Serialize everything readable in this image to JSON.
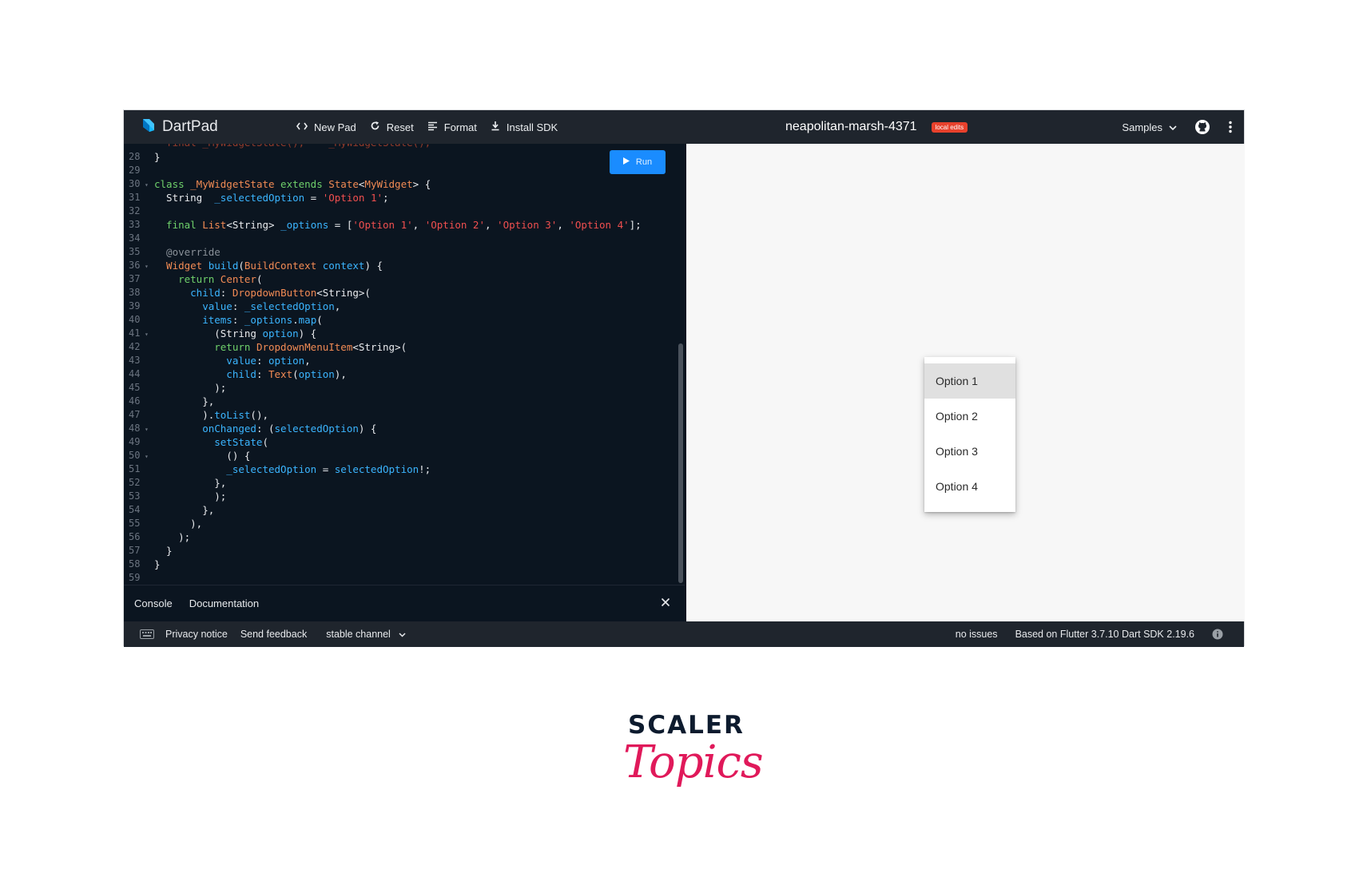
{
  "app": {
    "brand": "DartPad",
    "toolbar": {
      "new_pad": "New Pad",
      "reset": "Reset",
      "format": "Format",
      "install_sdk": "Install SDK"
    },
    "pad_name": "neapolitan-marsh-4371",
    "local_edits_badge": "local edits",
    "samples": "Samples",
    "icons": {
      "brand": "dart-logo-icon",
      "new_pad": "code-brackets-icon",
      "reset": "refresh-icon",
      "format": "align-lines-icon",
      "install_sdk": "download-icon",
      "samples": "chevron-down-icon",
      "github": "github-icon",
      "more": "more-vert-icon"
    },
    "colors": {
      "topbar": "#1f252d",
      "editor_bg": "#0b1520",
      "run_button": "#1a8cff",
      "badge": "#e8412c",
      "output_bg": "#f7f7f7"
    }
  },
  "editor": {
    "run_label": "Run",
    "lines": [
      {
        "n": "28",
        "fold": "",
        "tokens": [
          {
            "t": "}",
            "c": "plain"
          }
        ]
      },
      {
        "n": "29",
        "fold": "",
        "tokens": []
      },
      {
        "n": "30",
        "fold": "▾",
        "tokens": [
          {
            "t": "class ",
            "c": "green"
          },
          {
            "t": "_MyWidgetState",
            "c": "type"
          },
          {
            "t": " extends ",
            "c": "green"
          },
          {
            "t": "State",
            "c": "type"
          },
          {
            "t": "<",
            "c": "plain"
          },
          {
            "t": "MyWidget",
            "c": "type"
          },
          {
            "t": "> {",
            "c": "plain"
          }
        ]
      },
      {
        "n": "31",
        "fold": "",
        "tokens": [
          {
            "t": "  String  ",
            "c": "plain"
          },
          {
            "t": "_selectedOption",
            "c": "blue"
          },
          {
            "t": " = ",
            "c": "plain"
          },
          {
            "t": "'Option 1'",
            "c": "str"
          },
          {
            "t": ";",
            "c": "plain"
          }
        ]
      },
      {
        "n": "32",
        "fold": "",
        "tokens": []
      },
      {
        "n": "33",
        "fold": "",
        "tokens": [
          {
            "t": "  final ",
            "c": "green"
          },
          {
            "t": "List",
            "c": "type"
          },
          {
            "t": "<String> ",
            "c": "plain"
          },
          {
            "t": "_options",
            "c": "blue"
          },
          {
            "t": " = [",
            "c": "plain"
          },
          {
            "t": "'Option 1'",
            "c": "str"
          },
          {
            "t": ", ",
            "c": "plain"
          },
          {
            "t": "'Option 2'",
            "c": "str"
          },
          {
            "t": ", ",
            "c": "plain"
          },
          {
            "t": "'Option 3'",
            "c": "str"
          },
          {
            "t": ", ",
            "c": "plain"
          },
          {
            "t": "'Option 4'",
            "c": "str"
          },
          {
            "t": "];",
            "c": "plain"
          }
        ]
      },
      {
        "n": "34",
        "fold": "",
        "tokens": []
      },
      {
        "n": "35",
        "fold": "",
        "tokens": [
          {
            "t": "  @override",
            "c": "ann"
          }
        ]
      },
      {
        "n": "36",
        "fold": "▾",
        "tokens": [
          {
            "t": "  Widget ",
            "c": "type"
          },
          {
            "t": "build",
            "c": "blue"
          },
          {
            "t": "(",
            "c": "plain"
          },
          {
            "t": "BuildContext",
            "c": "type"
          },
          {
            "t": " context",
            "c": "blue"
          },
          {
            "t": ") {",
            "c": "plain"
          }
        ]
      },
      {
        "n": "37",
        "fold": "",
        "tokens": [
          {
            "t": "    return ",
            "c": "green"
          },
          {
            "t": "Center",
            "c": "type"
          },
          {
            "t": "(",
            "c": "plain"
          }
        ]
      },
      {
        "n": "38",
        "fold": "",
        "tokens": [
          {
            "t": "      child",
            "c": "blue"
          },
          {
            "t": ": ",
            "c": "plain"
          },
          {
            "t": "DropdownButton",
            "c": "type"
          },
          {
            "t": "<String>(",
            "c": "plain"
          }
        ]
      },
      {
        "n": "39",
        "fold": "",
        "tokens": [
          {
            "t": "        value",
            "c": "blue"
          },
          {
            "t": ": ",
            "c": "plain"
          },
          {
            "t": "_selectedOption",
            "c": "blue"
          },
          {
            "t": ",",
            "c": "plain"
          }
        ]
      },
      {
        "n": "40",
        "fold": "",
        "tokens": [
          {
            "t": "        items",
            "c": "blue"
          },
          {
            "t": ": ",
            "c": "plain"
          },
          {
            "t": "_options",
            "c": "blue"
          },
          {
            "t": ".",
            "c": "plain"
          },
          {
            "t": "map",
            "c": "blue"
          },
          {
            "t": "(",
            "c": "plain"
          }
        ]
      },
      {
        "n": "41",
        "fold": "▾",
        "tokens": [
          {
            "t": "          (String ",
            "c": "plain"
          },
          {
            "t": "option",
            "c": "blue"
          },
          {
            "t": ") {",
            "c": "plain"
          }
        ]
      },
      {
        "n": "42",
        "fold": "",
        "tokens": [
          {
            "t": "          return ",
            "c": "green"
          },
          {
            "t": "DropdownMenuItem",
            "c": "type"
          },
          {
            "t": "<String>(",
            "c": "plain"
          }
        ]
      },
      {
        "n": "43",
        "fold": "",
        "tokens": [
          {
            "t": "            value",
            "c": "blue"
          },
          {
            "t": ": ",
            "c": "plain"
          },
          {
            "t": "option",
            "c": "blue"
          },
          {
            "t": ",",
            "c": "plain"
          }
        ]
      },
      {
        "n": "44",
        "fold": "",
        "tokens": [
          {
            "t": "            child",
            "c": "blue"
          },
          {
            "t": ": ",
            "c": "plain"
          },
          {
            "t": "Text",
            "c": "type"
          },
          {
            "t": "(",
            "c": "plain"
          },
          {
            "t": "option",
            "c": "blue"
          },
          {
            "t": "),",
            "c": "plain"
          }
        ]
      },
      {
        "n": "45",
        "fold": "",
        "tokens": [
          {
            "t": "          );",
            "c": "plain"
          }
        ]
      },
      {
        "n": "46",
        "fold": "",
        "tokens": [
          {
            "t": "        },",
            "c": "plain"
          }
        ]
      },
      {
        "n": "47",
        "fold": "",
        "tokens": [
          {
            "t": "        ).",
            "c": "plain"
          },
          {
            "t": "toList",
            "c": "blue"
          },
          {
            "t": "(),",
            "c": "plain"
          }
        ]
      },
      {
        "n": "48",
        "fold": "▾",
        "tokens": [
          {
            "t": "        onChanged",
            "c": "blue"
          },
          {
            "t": ": (",
            "c": "plain"
          },
          {
            "t": "selectedOption",
            "c": "blue"
          },
          {
            "t": ") {",
            "c": "plain"
          }
        ]
      },
      {
        "n": "49",
        "fold": "",
        "tokens": [
          {
            "t": "          setState",
            "c": "blue"
          },
          {
            "t": "(",
            "c": "plain"
          }
        ]
      },
      {
        "n": "50",
        "fold": "▾",
        "tokens": [
          {
            "t": "            () {",
            "c": "plain"
          }
        ]
      },
      {
        "n": "51",
        "fold": "",
        "tokens": [
          {
            "t": "            _selectedOption",
            "c": "blue"
          },
          {
            "t": " = ",
            "c": "plain"
          },
          {
            "t": "selectedOption",
            "c": "blue"
          },
          {
            "t": "!;",
            "c": "plain"
          }
        ]
      },
      {
        "n": "52",
        "fold": "",
        "tokens": [
          {
            "t": "          },",
            "c": "plain"
          }
        ]
      },
      {
        "n": "53",
        "fold": "",
        "tokens": [
          {
            "t": "          );",
            "c": "plain"
          }
        ]
      },
      {
        "n": "54",
        "fold": "",
        "tokens": [
          {
            "t": "        },",
            "c": "plain"
          }
        ]
      },
      {
        "n": "55",
        "fold": "",
        "tokens": [
          {
            "t": "      ),",
            "c": "plain"
          }
        ]
      },
      {
        "n": "56",
        "fold": "",
        "tokens": [
          {
            "t": "    );",
            "c": "plain"
          }
        ]
      },
      {
        "n": "57",
        "fold": "",
        "tokens": [
          {
            "t": "  }",
            "c": "plain"
          }
        ]
      },
      {
        "n": "58",
        "fold": "",
        "tokens": [
          {
            "t": "}",
            "c": "plain"
          }
        ]
      },
      {
        "n": "59",
        "fold": "",
        "tokens": []
      }
    ]
  },
  "console": {
    "tabs": [
      "Console",
      "Documentation"
    ],
    "close_icon": "close-icon"
  },
  "output": {
    "menu_items": [
      "Option 1",
      "Option 2",
      "Option 3",
      "Option 4"
    ],
    "selected": "Option 1"
  },
  "status": {
    "keyboard_icon": "keyboard-icon",
    "privacy": "Privacy notice",
    "feedback": "Send feedback",
    "channel": "stable channel",
    "issues": "no issues",
    "version": "Based on Flutter 3.7.10 Dart SDK 2.19.6",
    "info_icon": "info-icon"
  },
  "logo": {
    "top": "SCALER",
    "bottom": "Topics"
  }
}
